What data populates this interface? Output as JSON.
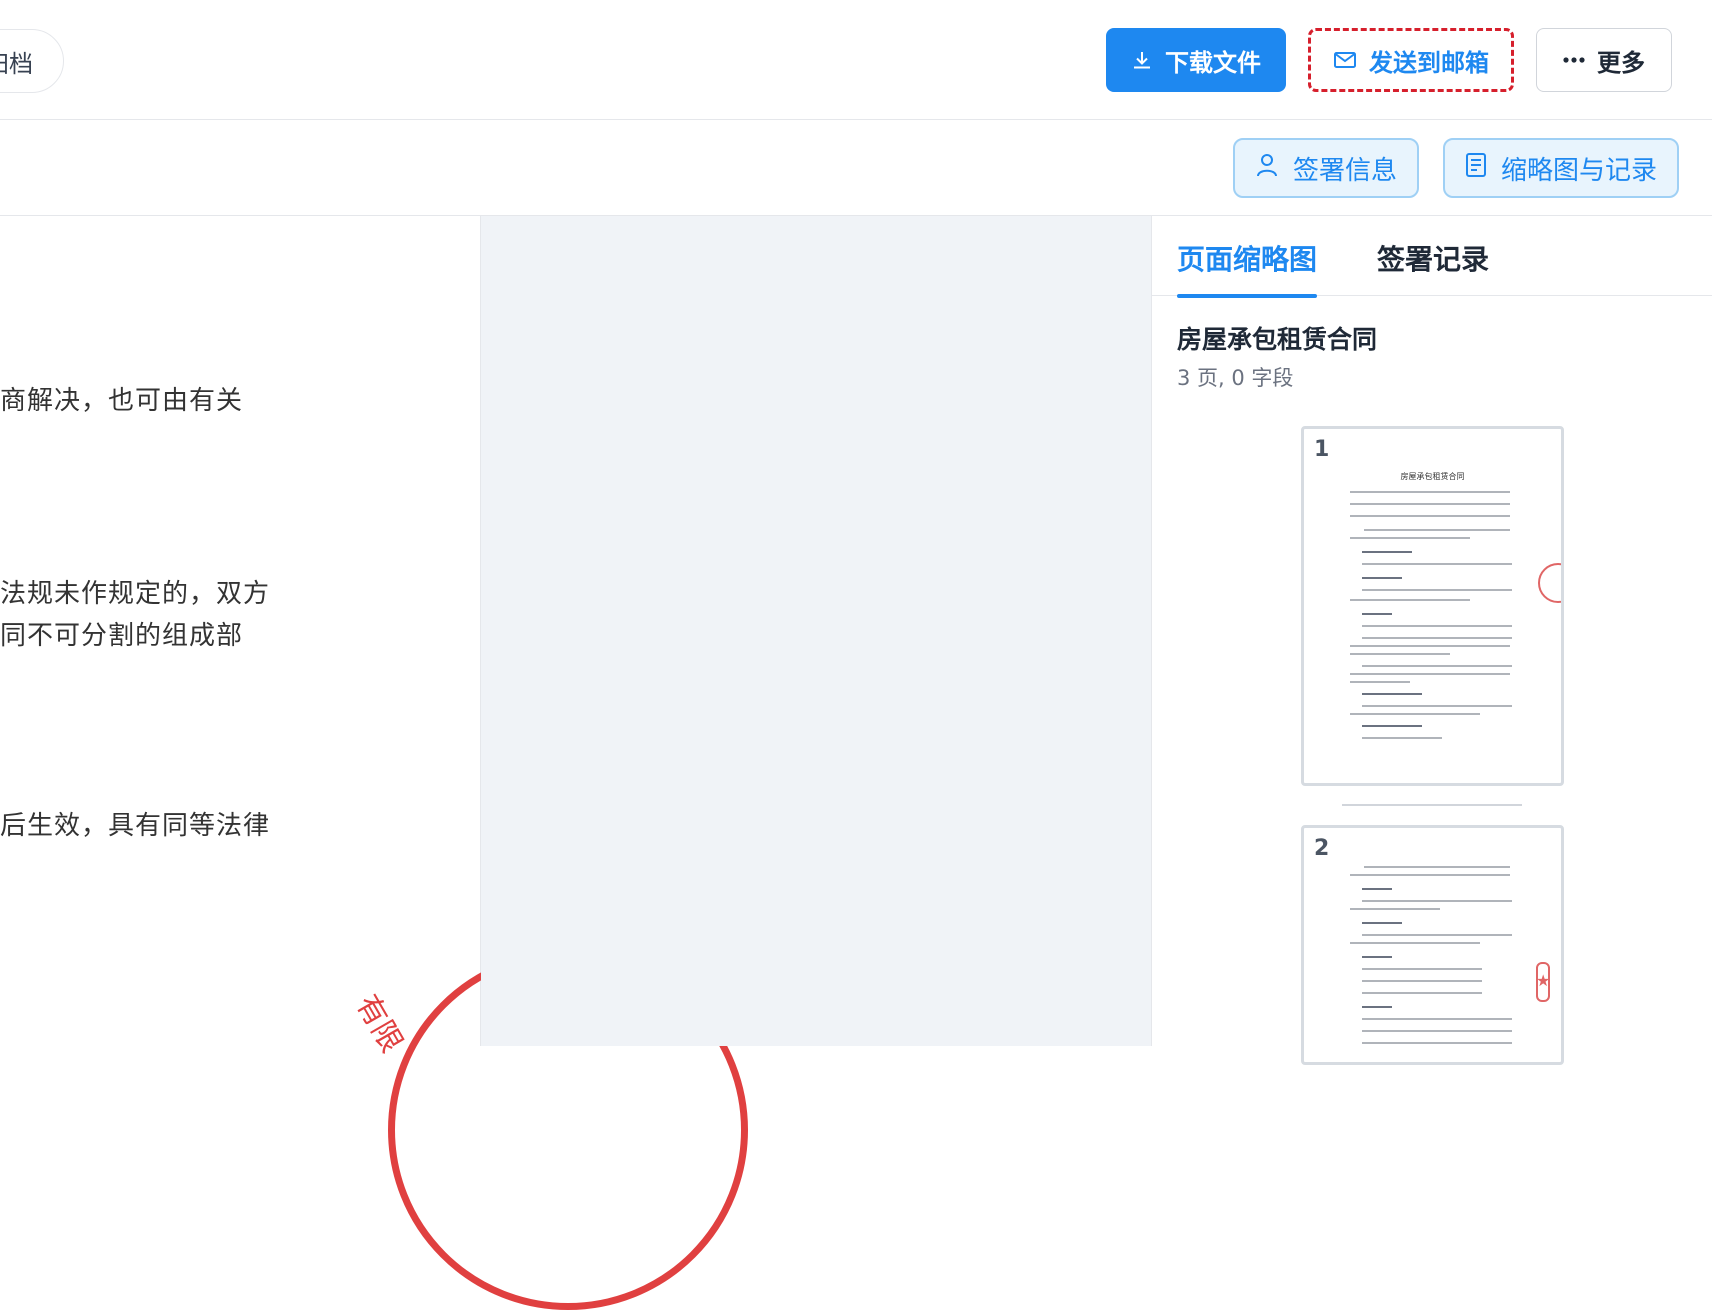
{
  "header": {
    "archive_label": "归档",
    "download_label": "下载文件",
    "email_label": "发送到邮箱",
    "more_label": "更多"
  },
  "toolbar": {
    "sign_info_label": "签署信息",
    "thumbnails_label": "缩略图与记录"
  },
  "document": {
    "lines": [
      "商解决，也可由有关",
      "法规未作规定的，双方",
      "同不可分割的组成部",
      "后生效，具有同等法律"
    ],
    "seal_text": "有限"
  },
  "panel": {
    "tabs": [
      {
        "label": "页面缩略图",
        "active": true
      },
      {
        "label": "签署记录",
        "active": false
      }
    ],
    "doc_title": "房屋承包租赁合同",
    "doc_meta": "3 页, 0 字段",
    "thumbnails": [
      {
        "page": "1",
        "mini_title": "房屋承包租赁合同"
      },
      {
        "page": "2"
      }
    ]
  },
  "colors": {
    "primary": "#1e88f0",
    "email_outline": "#d61f2c",
    "seal": "#e04040",
    "canvas_bg": "#f0f3f7"
  }
}
